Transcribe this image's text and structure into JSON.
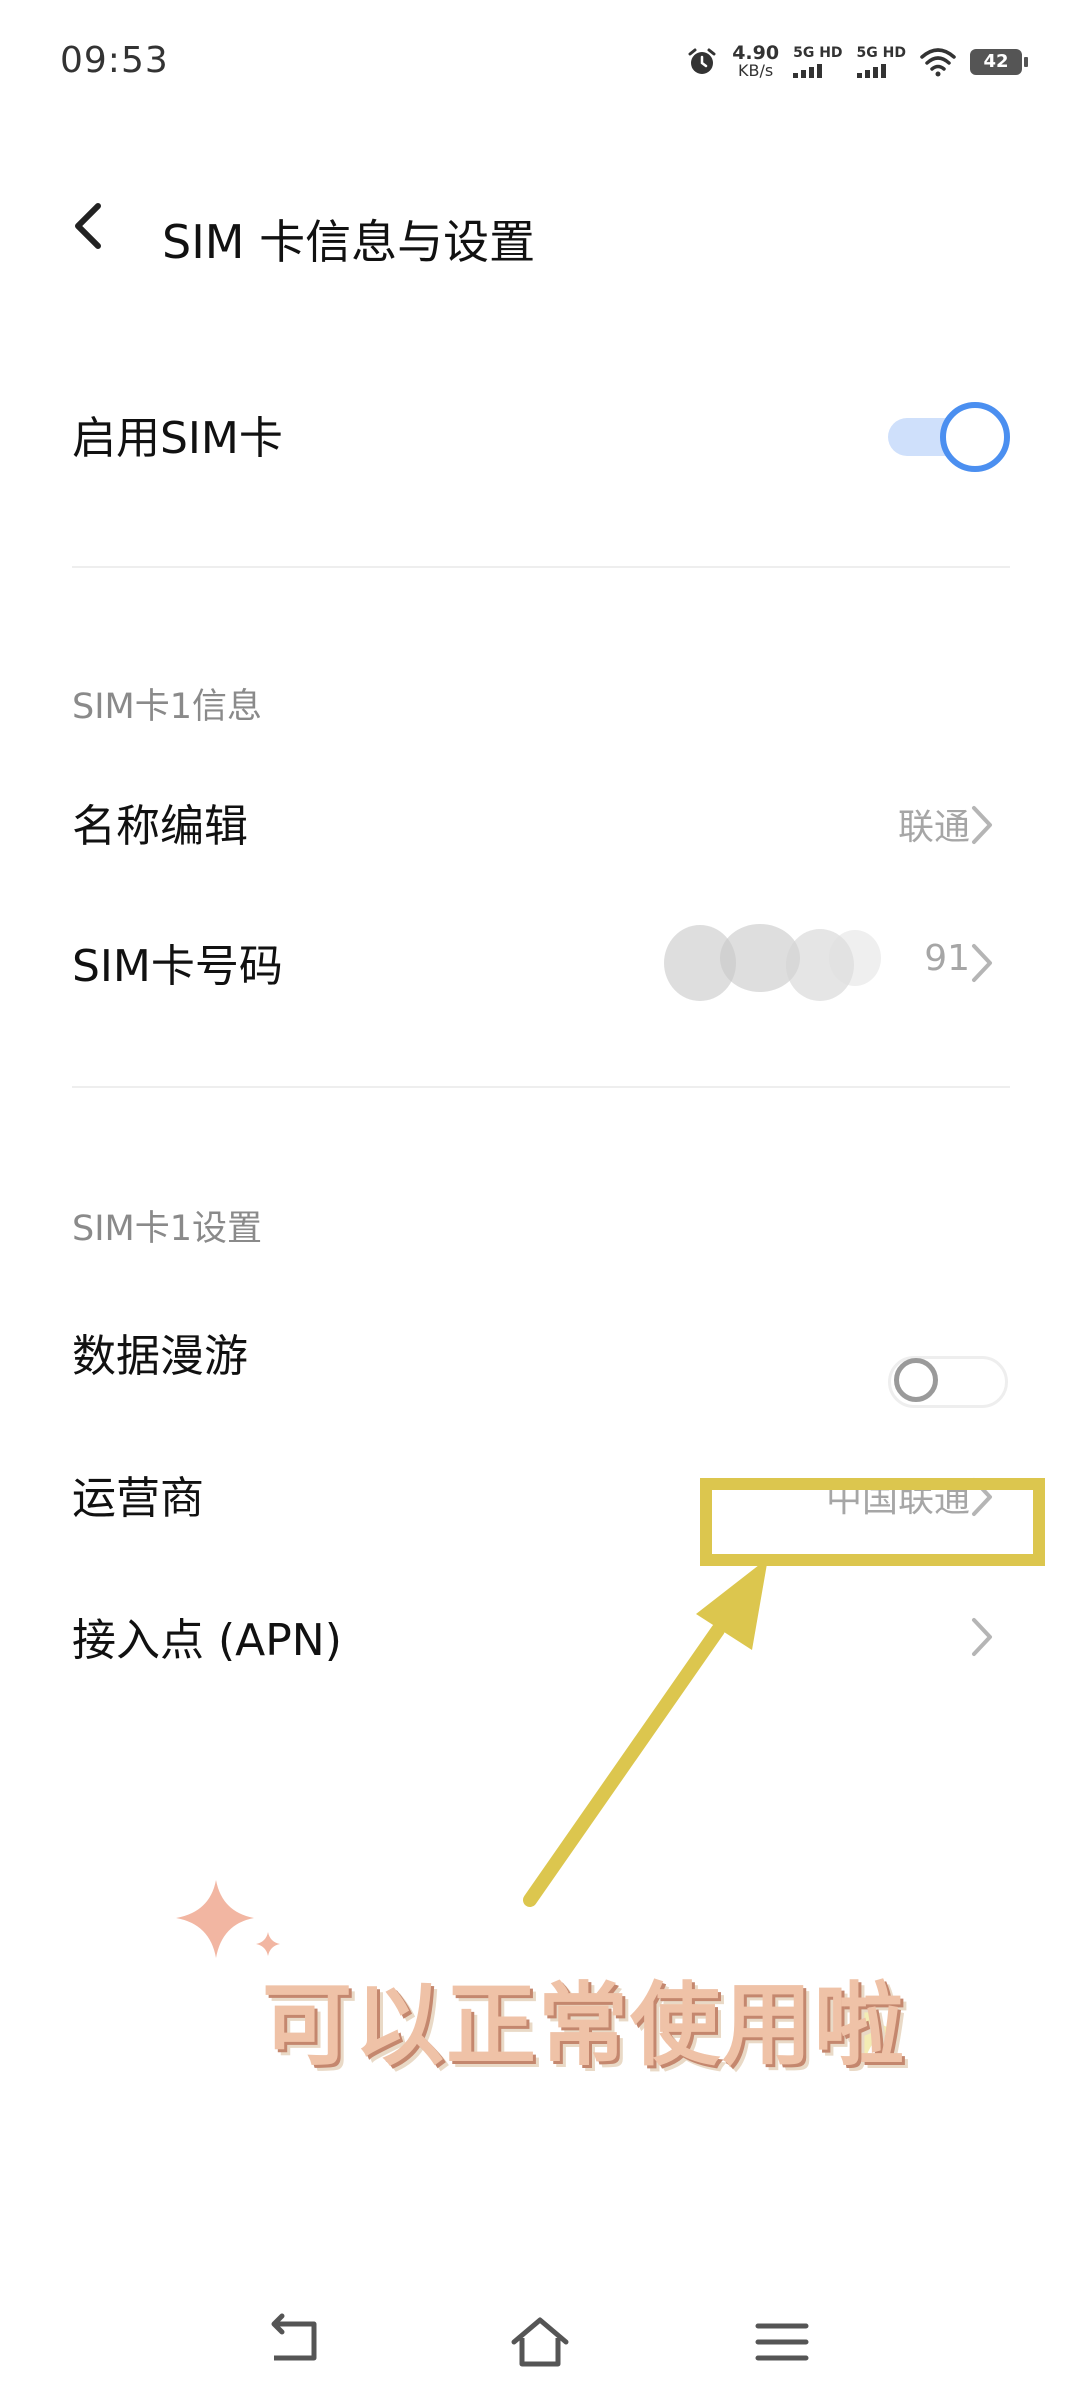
{
  "status_bar": {
    "time": "09:53",
    "net_speed_value": "4.90",
    "net_speed_unit": "KB/s",
    "sim1_label": "5G HD",
    "sim2_label": "5G HD",
    "battery": "42"
  },
  "header": {
    "title": "SIM 卡信息与设置"
  },
  "enable_sim": {
    "label": "启用SIM卡",
    "enabled": true
  },
  "sim_info": {
    "section_title": "SIM卡1信息",
    "name_edit": {
      "label": "名称编辑",
      "value": "联通"
    },
    "sim_number": {
      "label": "SIM卡号码",
      "value": "91"
    }
  },
  "sim_settings": {
    "section_title": "SIM卡1设置",
    "data_roaming": {
      "label": "数据漫游",
      "enabled": false
    },
    "carrier": {
      "label": "运营商",
      "value": "中国联通"
    },
    "apn": {
      "label": "接入点 (APN)"
    }
  },
  "annotation": {
    "text": "可以正常使用啦",
    "highlight_color": "#dcc64e"
  },
  "colors": {
    "accent": "#4b8ff0",
    "annotation_text": "#efc2a7"
  }
}
